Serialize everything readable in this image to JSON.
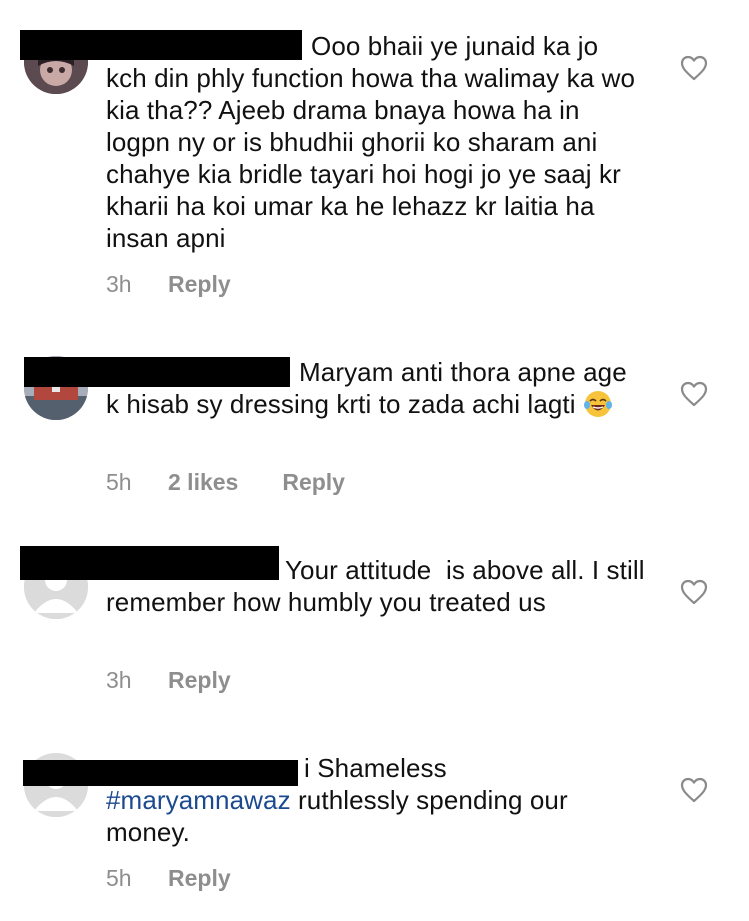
{
  "comments": [
    {
      "text": "Ooo bhaii ye junaid ka jo kch din phly function howa tha walimay ka wo kia tha?? Ajeeb drama bnaya howa ha in logpn ny or is bhudhii ghorii ko sharam ani chahye kia bridle tayari hoi hogi jo ye saaj kr kharii ha koi umar ka he lehazz kr laitia ha insan apni",
      "time": "3h",
      "likes": "",
      "reply_label": "Reply"
    },
    {
      "text": "Maryam anti thora apne age k hisab sy dressing krti to zada achi lagti",
      "emoji": "laughing-tears",
      "time": "5h",
      "likes": "2 likes",
      "reply_label": "Reply"
    },
    {
      "text": "Your attitude  is above all. I still remember how humbly you treated us",
      "time": "3h",
      "likes": "",
      "reply_label": "Reply"
    },
    {
      "text_visible_name_tail": "i",
      "text_before_tag": "Shameless",
      "hashtag": "#maryamnawaz",
      "text_after_tag": "ruthlessly spending our money.",
      "time": "5h",
      "likes": "",
      "reply_label": "Reply"
    }
  ],
  "colors": {
    "text": "#111111",
    "meta": "#8e8e8e",
    "hashtag": "#1c4a8f",
    "redaction": "#000000"
  },
  "icons": {
    "like": "heart-outline-icon",
    "avatar": "profile-avatar"
  }
}
